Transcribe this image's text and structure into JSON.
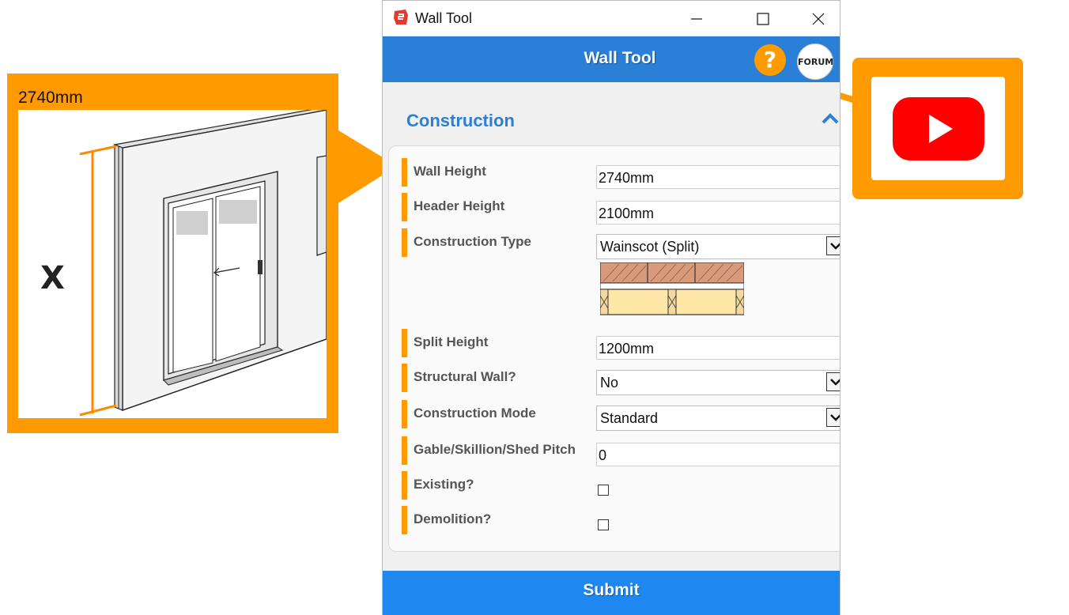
{
  "preview": {
    "value": "2740mm",
    "dimension_label": "X"
  },
  "window": {
    "title": "Wall Tool",
    "controls": [
      "minimize-icon",
      "maximize-icon",
      "close-icon"
    ]
  },
  "header": {
    "title": "Wall Tool",
    "help_label": "?",
    "forum_label": "FORUM"
  },
  "section": {
    "title": "Construction",
    "collapse_icon": "chevron-up-icon"
  },
  "fields": {
    "wall_height": {
      "label": "Wall Height",
      "value": "2740mm"
    },
    "header_height": {
      "label": "Header Height",
      "value": "2100mm"
    },
    "construction_type": {
      "label": "Construction Type",
      "value": "Wainscot (Split)"
    },
    "split_height": {
      "label": "Split Height",
      "value": "1200mm"
    },
    "structural_wall": {
      "label": "Structural Wall?",
      "value": "No"
    },
    "construction_mode": {
      "label": "Construction Mode",
      "value": "Standard"
    },
    "pitch": {
      "label": "Gable/Skillion/Shed Pitch",
      "value": "0"
    },
    "existing": {
      "label": "Existing?",
      "checked": false
    },
    "demolition": {
      "label": "Demolition?",
      "checked": false
    }
  },
  "submit_label": "Submit",
  "colors": {
    "accent_orange": "#ff9a00",
    "header_blue": "#2a7fd6",
    "submit_blue": "#1e88f0",
    "youtube_red": "#ff0000"
  },
  "video_icon": "youtube-play-icon"
}
